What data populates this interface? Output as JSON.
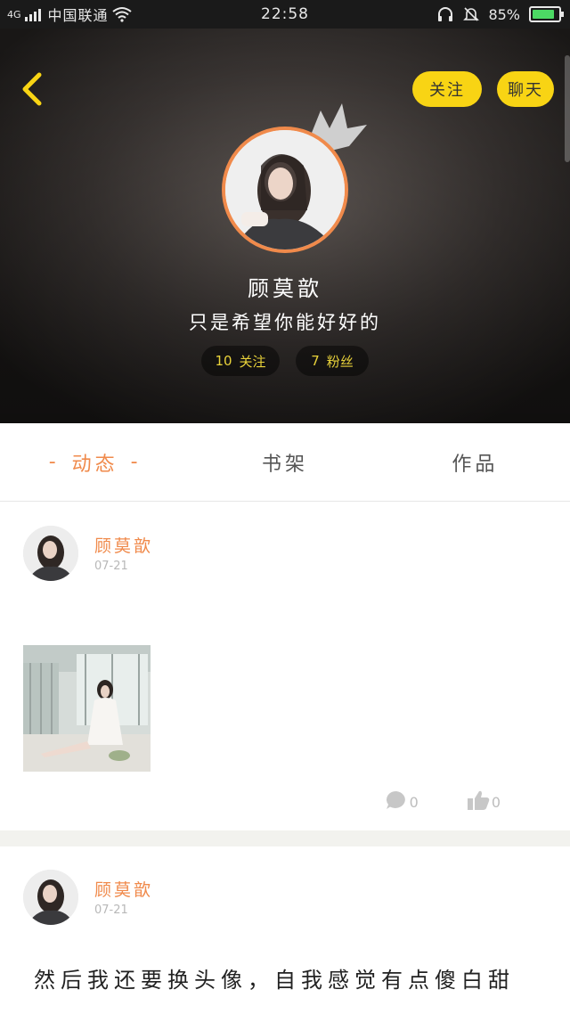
{
  "status_bar": {
    "network": "4G",
    "carrier": "中国联通",
    "time": "22:58",
    "battery": "85%",
    "battery_level": 0.85
  },
  "header": {
    "follow_label": "关注",
    "chat_label": "聊天",
    "name": "顾莫歆",
    "bio": "只是希望你能好好的",
    "following_count": "10",
    "following_label": "关注",
    "fans_count": "7",
    "fans_label": "粉丝"
  },
  "tabs": [
    {
      "label": "动态",
      "active": true
    },
    {
      "label": "书架",
      "active": false
    },
    {
      "label": "作品",
      "active": false
    }
  ],
  "tab_dash": "-",
  "posts": [
    {
      "author": "顾莫歆",
      "date": "07-21",
      "comments": "0",
      "likes": "0"
    },
    {
      "author": "顾莫歆",
      "date": "07-21",
      "text": "然后我还要换头像，自我感觉有点傻白甜"
    }
  ],
  "colors": {
    "accent": "#f08a4b",
    "button_yellow": "#f8d414",
    "stat_yellow": "#e8d23a",
    "divider": "#f2f2ee"
  }
}
